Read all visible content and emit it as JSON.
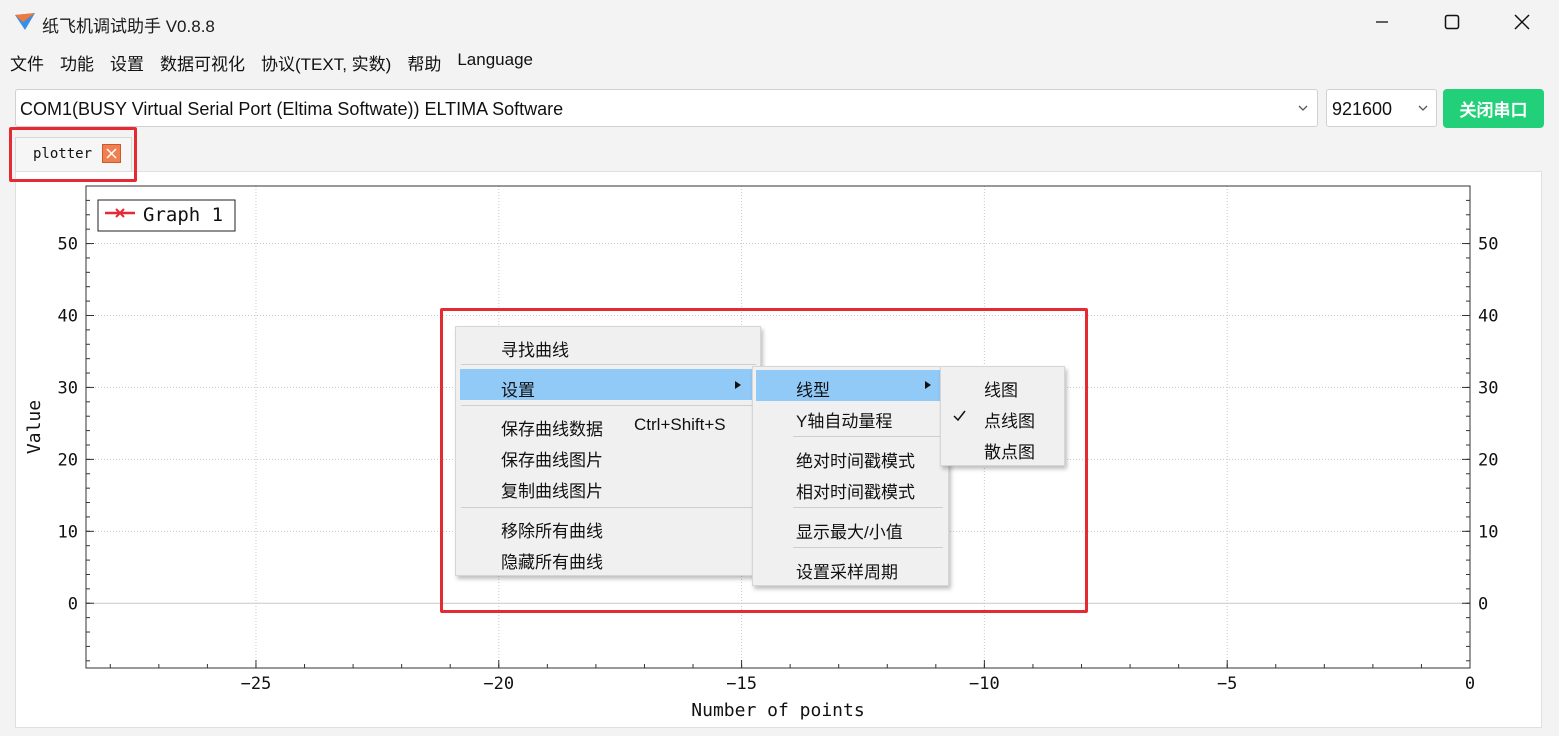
{
  "window": {
    "title": "纸飞机调试助手 V0.8.8",
    "icons": {
      "app": "paper-plane-icon",
      "minimize": "minimize-icon",
      "maximize": "maximize-icon",
      "close": "close-icon"
    }
  },
  "menubar": {
    "items": [
      "文件",
      "功能",
      "设置",
      "数据可视化",
      "协议(TEXT, 实数)",
      "帮助",
      "Language"
    ]
  },
  "serial": {
    "port": "COM1(BUSY  Virtual Serial Port (Eltima Softwate)) ELTIMA Software",
    "baud": "921600",
    "close_button": "关闭串口",
    "button_color": "#22d07a"
  },
  "tabs": [
    {
      "label": "plotter",
      "close_icon": "close-icon",
      "close_color": "#f08050"
    }
  ],
  "chart_data": {
    "type": "line",
    "xlabel": "Number of points",
    "ylabel": "Value",
    "x_ticks": [
      "−25",
      "−20",
      "−15",
      "−10",
      "−5",
      "0"
    ],
    "y_ticks": [
      "0",
      "10",
      "20",
      "30",
      "40",
      "50"
    ],
    "xlim": [
      -28.5,
      0
    ],
    "ylim": [
      -9,
      58
    ],
    "grid": true,
    "legend": {
      "position": "top-left",
      "entries": [
        "Graph 1"
      ]
    },
    "series": [
      {
        "name": "Graph 1",
        "color": "#e52a33",
        "marker": "x",
        "values": []
      }
    ]
  },
  "context_menu": {
    "items": [
      {
        "label": "寻找曲线"
      },
      {
        "label": "设置",
        "submenu": true,
        "highlighted": true
      },
      {
        "label": "保存曲线数据",
        "shortcut": "Ctrl+Shift+S"
      },
      {
        "label": "保存曲线图片"
      },
      {
        "label": "复制曲线图片"
      },
      {
        "label": "移除所有曲线"
      },
      {
        "label": "隐藏所有曲线"
      }
    ],
    "settings_submenu": [
      {
        "label": "线型",
        "submenu": true,
        "highlighted": true
      },
      {
        "label": "Y轴自动量程"
      },
      {
        "label": "绝对时间戳模式"
      },
      {
        "label": "相对时间戳模式"
      },
      {
        "label": "显示最大/小值"
      },
      {
        "label": "设置采样周期"
      }
    ],
    "linetype_submenu": [
      {
        "label": "线图",
        "checked": false
      },
      {
        "label": "点线图",
        "checked": true
      },
      {
        "label": "散点图",
        "checked": false
      }
    ],
    "highlight_color": "#91c9f7"
  },
  "annotation_color": "#e52a33"
}
